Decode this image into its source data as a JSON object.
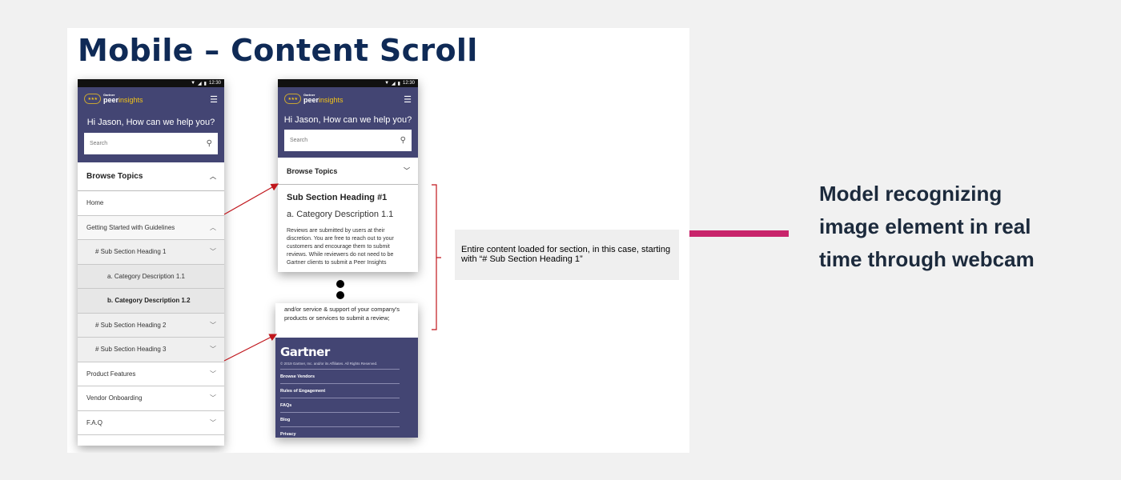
{
  "slide": {
    "title": "Mobile – Content Scroll"
  },
  "status_bar": {
    "time": "12:30"
  },
  "app": {
    "logo_top": "Gartner",
    "logo_peer": "peer",
    "logo_insights": "insights",
    "greeting": "Hi Jason, How can we help you?",
    "search_placeholder": "Search"
  },
  "phone1": {
    "browse_topics": "Browse Topics",
    "rows": {
      "home": "Home",
      "getting_started": "Getting Started with Guidelines",
      "sub1": "# Sub Section Heading 1",
      "cat11": "a. Category Description 1.1",
      "cat12": "b. Category Description 1.2",
      "sub2": "# Sub Section Heading 2",
      "sub3": "# Sub Section Heading 3",
      "product_features": "Product Features",
      "vendor_onboarding": "Vendor Onboarding",
      "faq": "F.A.Q"
    }
  },
  "phone2": {
    "browse_topics": "Browse Topics",
    "section_heading": "Sub Section Heading #1",
    "category": "a. Category Description 1.1",
    "paragraph": "Reviews are submitted by users at their discretion. You are free to reach out to your customers and encourage them to submit reviews. While reviewers do not need to be Gartner clients to submit a Peer Insights"
  },
  "phone3": {
    "text": "and/or service & support of your company's products or services to submit a review;",
    "footer_logo": "Gartner",
    "copyright": "© 2019 Gartner, Inc. and/or its Affiliates. All Rights Reserved.",
    "links": [
      "Browse Vendors",
      "Rules of Engagement",
      "FAQs",
      "Blog",
      "Privacy"
    ]
  },
  "callout": {
    "text": "Entire content loaded for section, in this case, starting with “# Sub Section Heading 1”"
  },
  "right_text": "Model recognizing image element in real time through webcam",
  "colors": {
    "header_purple": "#434573",
    "title_navy": "#0f2a56",
    "pink_bar": "#c8246b",
    "arrow_red": "#c0161c"
  },
  "icons": {
    "menu": "hamburger-icon",
    "search": "search-icon",
    "chevron": "chevron-icon"
  }
}
